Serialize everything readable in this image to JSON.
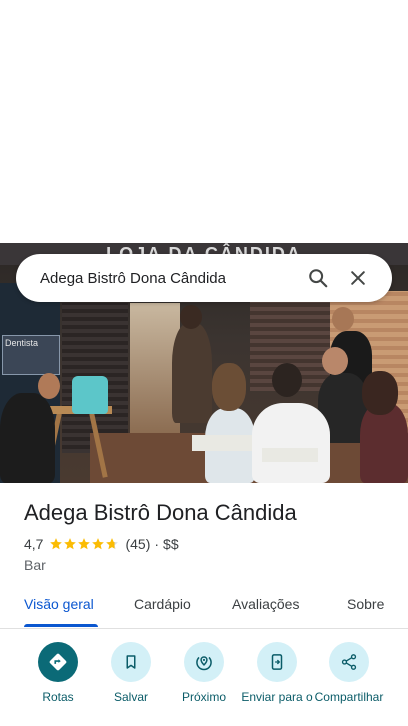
{
  "photo": {
    "top_sign_text": "LOJA DA CÂNDIDA",
    "left_sign_text": "Dentista"
  },
  "search": {
    "query": "Adega Bistrô Dona Cândida",
    "search_icon": "search-icon",
    "close_icon": "close-icon"
  },
  "place": {
    "name": "Adega Bistrô Dona Cândida",
    "rating": "4,7",
    "rating_value": 4.7,
    "review_count": "(45)",
    "separator": "·",
    "price": "$$",
    "category": "Bar",
    "star_color": "#fbbc04"
  },
  "tabs": [
    {
      "label": "Visão geral",
      "active": true
    },
    {
      "label": "Cardápio",
      "active": false
    },
    {
      "label": "Avaliações",
      "active": false
    },
    {
      "label": "Sobre",
      "active": false
    }
  ],
  "actions": [
    {
      "label": "Rotas",
      "icon": "directions-icon"
    },
    {
      "label": "Salvar",
      "icon": "bookmark-icon"
    },
    {
      "label": "Próximo",
      "icon": "nearby-icon"
    },
    {
      "label": "Enviar para o",
      "icon": "send-to-phone-icon"
    },
    {
      "label": "Compartilhar",
      "icon": "share-icon"
    }
  ],
  "colors": {
    "accent": "#0b57d0",
    "action_primary": "#0b6a77",
    "action_secondary": "#d3f0f7"
  }
}
